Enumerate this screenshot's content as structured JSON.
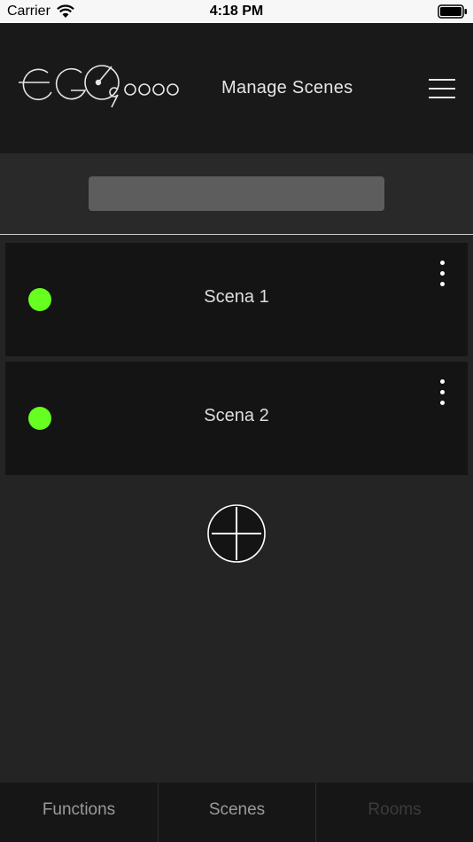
{
  "status_bar": {
    "carrier": "Carrier",
    "time": "4:18 PM"
  },
  "header": {
    "title": "Manage Scenes",
    "logo_icon": "ego-9000-logo"
  },
  "search": {
    "value": "",
    "placeholder": ""
  },
  "scenes": [
    {
      "name": "Scena 1",
      "status_color": "#66ff1f"
    },
    {
      "name": "Scena 2",
      "status_color": "#66ff1f"
    }
  ],
  "tabs": [
    {
      "label": "Functions",
      "color": "#9a9a9a"
    },
    {
      "label": "Scenes",
      "color": "#9a9a9a"
    },
    {
      "label": "Rooms",
      "color": "#3b3b3b"
    }
  ],
  "colors": {
    "background": "#242424",
    "header": "#191919",
    "row": "#141414",
    "accent_green": "#66ff1f"
  }
}
